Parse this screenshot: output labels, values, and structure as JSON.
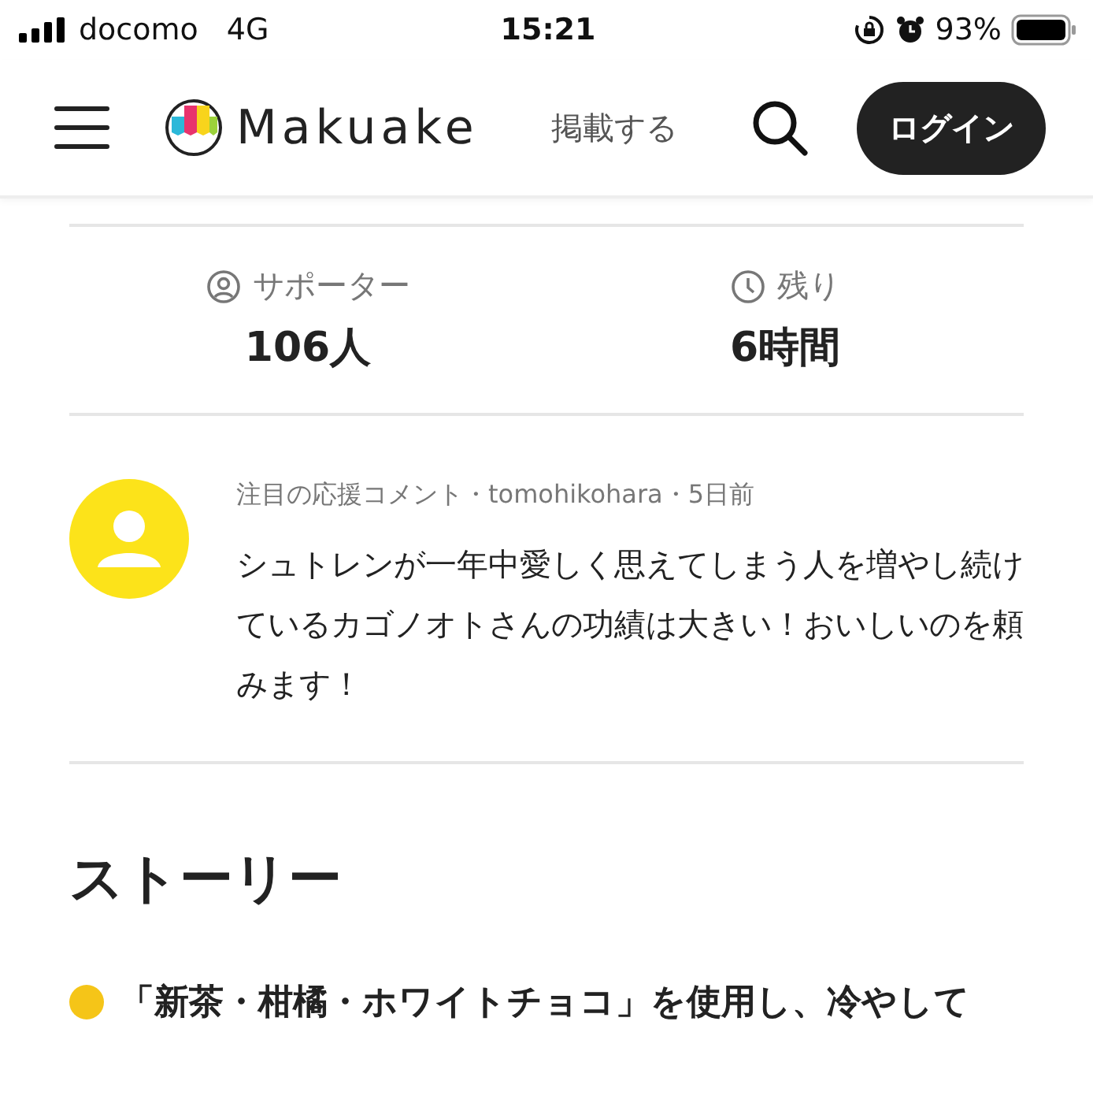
{
  "status_bar": {
    "carrier": "docomo",
    "network": "4G",
    "time": "15:21",
    "battery": "93%"
  },
  "header": {
    "logo": "Makuake",
    "post_link": "掲載する",
    "login_button": "ログイン"
  },
  "stats": [
    {
      "kind": "person",
      "label": "サポーター",
      "value": "106人"
    },
    {
      "kind": "clock",
      "label": "残り",
      "value": "6時間"
    }
  ],
  "comment": {
    "meta": "注目の応援コメント・tomohikohara・5日前",
    "text": "シュトレンが一年中愛しく思えてしまう人を増やし続けているカゴノオトさんの功績は大きい！おいしいのを頼みます！"
  },
  "story": {
    "heading": "ストーリー",
    "bullets": [
      {
        "text": "「新茶・柑橘・ホワイトチョコ」を使用し、冷やして",
        "color": "#f5c518"
      }
    ]
  }
}
